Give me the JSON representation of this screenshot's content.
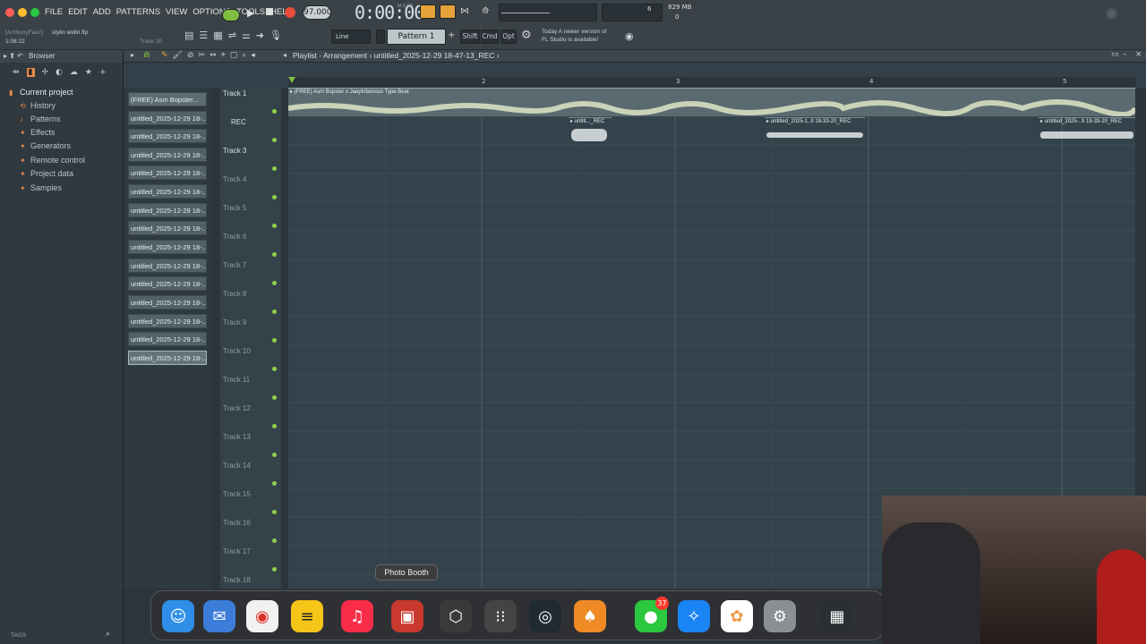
{
  "menu": [
    "FILE",
    "EDIT",
    "ADD",
    "PATTERNS",
    "VIEW",
    "OPTIONS",
    "TOOLS",
    "HELP"
  ],
  "toolbar": {
    "tempo": "97.000",
    "time": "0:00:00",
    "time_sub": "M:S:CS",
    "snap": "Line",
    "pattern": "Pattern 1",
    "shift": "Shift",
    "cmd": "Cmd",
    "opt": "Opt",
    "cpu_value": "6",
    "mem": "829 MB",
    "mem_sub": "0",
    "news_line1": "Today  A newer version of",
    "news_line2": "FL Studio is available!"
  },
  "hint": {
    "user": "[AnthonyFaez]",
    "file": "stylin widin.flp",
    "time": "1:08:22",
    "track": "Track 20"
  },
  "browser": {
    "title": "Browser",
    "items": [
      "Current project",
      "History",
      "Patterns",
      "Effects",
      "Generators",
      "Remote control",
      "Project data",
      "Samples"
    ],
    "tags": "TAGS"
  },
  "playlist": {
    "breadcrumb": "Playlist - Arrangement › untitled_2025-12-29 18-47-13_REC ›",
    "bars": [
      "2",
      "3",
      "4",
      "5"
    ],
    "patterns": [
      "(FREE) Asm Bopster...",
      "untitled_2025-12-29 18-...",
      "untitled_2025-12-29 18-...",
      "untitled_2025-12-29 18-...",
      "untitled_2025-12-29 18-...",
      "untitled_2025-12-29 18-...",
      "untitled_2025-12-29 18-...",
      "untitled_2025-12-29 18-...",
      "untitled_2025-12-29 18-...",
      "untitled_2025-12-29 18-...",
      "untitled_2025-12-29 18-...",
      "untitled_2025-12-29 18-...",
      "untitled_2025-12-29 18-...",
      "untitled_2025-12-29 18-...",
      "untitled_2025-12-29 18-..."
    ],
    "tracks": [
      "Track 1",
      "REC",
      "Track 3",
      "Track 4",
      "Track 5",
      "Track 6",
      "Track 7",
      "Track 8",
      "Track 9",
      "Track 10",
      "Track 11",
      "Track 12",
      "Track 13",
      "Track 14",
      "Track 15",
      "Track 16",
      "Track 17",
      "Track 18"
    ],
    "clips": {
      "beat": "▸ (FREE) Asm Bopster x JaayInfamous Type Beat",
      "rec1": "▸ untitl..._REC",
      "rec2": "▸ untitled_2025-1..9 18-33-20_REC",
      "rec3": "▸ untitled_2025-..9 18-33-20_REC"
    }
  },
  "dock": {
    "tooltip": "Photo Booth",
    "badge": "37",
    "apps": [
      "finder-icon",
      "mail-icon",
      "chrome-icon",
      "notes-icon",
      "music-icon",
      "photo-booth-icon",
      "blender-icon",
      "launchpad-icon",
      "obs-icon",
      "fl-studio-icon",
      "messages-icon",
      "safari-icon",
      "photos-icon",
      "settings-icon"
    ]
  }
}
